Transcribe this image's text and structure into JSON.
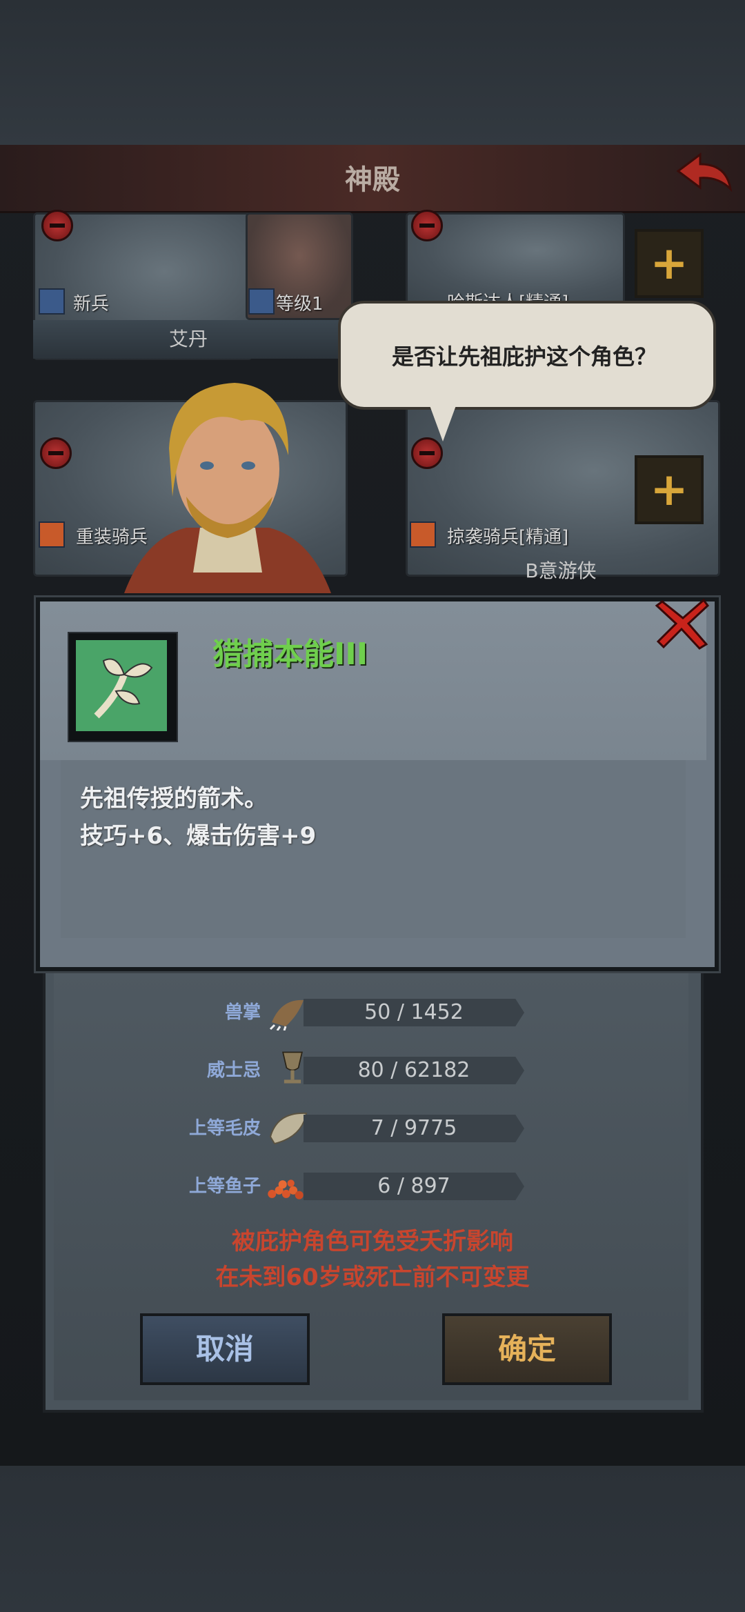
{
  "header": {
    "title": "神殿"
  },
  "cards": {
    "c1": {
      "tag": "新兵"
    },
    "c2": {
      "tag": "等级1"
    },
    "c3": {
      "tag": "哈斯达人[精通]"
    },
    "c1_name": "艾丹",
    "c4": {
      "tag": "重装骑兵"
    },
    "c5": {
      "tag": "掠袭骑兵[精通]"
    },
    "c5_name": "B意游侠"
  },
  "speech": {
    "text": "是否让先祖庇护这个角色？"
  },
  "skill": {
    "title": "猎捕本能III",
    "icon": "leaf-branch-icon",
    "desc_line1": "先祖传授的箭术。",
    "desc_line2": "技巧+6、爆击伤害+9"
  },
  "resources": [
    {
      "name": "兽掌",
      "value": "50 / 1452",
      "icon": "claw-icon"
    },
    {
      "name": "威士忌",
      "value": "80 / 62182",
      "icon": "goblet-icon"
    },
    {
      "name": "上等毛皮",
      "value": "7 / 9775",
      "icon": "fur-icon"
    },
    {
      "name": "上等鱼子",
      "value": "6 / 897",
      "icon": "roe-icon"
    }
  ],
  "warning": {
    "line1": "被庇护角色可免受夭折影响",
    "line2": "在未到60岁或死亡前不可变更"
  },
  "buttons": {
    "cancel": "取消",
    "confirm": "确定"
  },
  "colors": {
    "skill_title": "#6fcf4d",
    "warning": "#c8452e",
    "confirm": "#e6b25a",
    "cancel": "#a9c1e6"
  }
}
